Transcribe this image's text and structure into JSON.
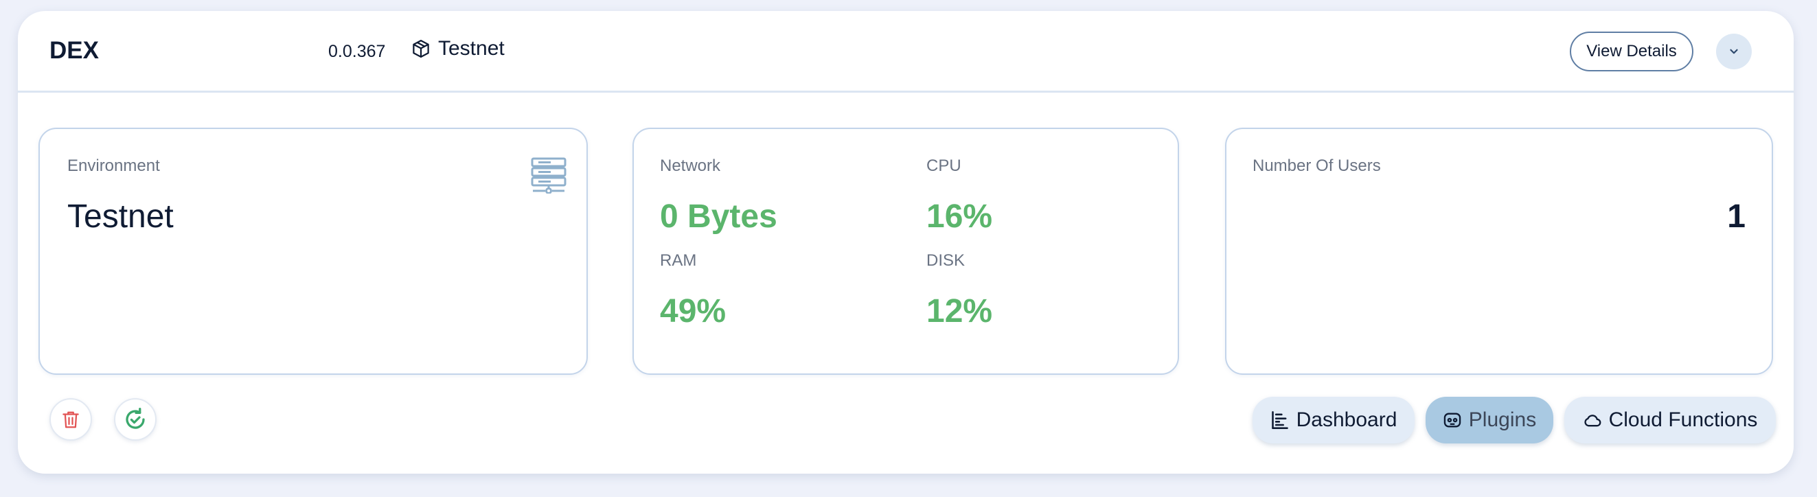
{
  "header": {
    "app_name": "DEX",
    "version": "0.0.367",
    "environment": "Testnet",
    "view_details_label": "View Details"
  },
  "environment_panel": {
    "label": "Environment",
    "value": "Testnet"
  },
  "resources_panel": {
    "network_label": "Network",
    "network_value": "0 Bytes",
    "cpu_label": "CPU",
    "cpu_value": "16%",
    "ram_label": "RAM",
    "ram_value": "49%",
    "disk_label": "DISK",
    "disk_value": "12%"
  },
  "users_panel": {
    "label": "Number Of Users",
    "value": "1"
  },
  "actions": {
    "dashboard_label": "Dashboard",
    "plugins_label": "Plugins",
    "cloud_functions_label": "Cloud Functions"
  },
  "colors": {
    "accent_green": "#5bb56c",
    "delete_red": "#e25454",
    "restart_green": "#3aa86c",
    "icon_blue": "#8fb0cc",
    "active_tab": "#a9c9e2"
  },
  "icons": [
    "package-icon",
    "chevron-down-icon",
    "server-icon",
    "trash-icon",
    "restart-icon",
    "dashboard-icon",
    "plugins-icon",
    "cloud-icon"
  ]
}
